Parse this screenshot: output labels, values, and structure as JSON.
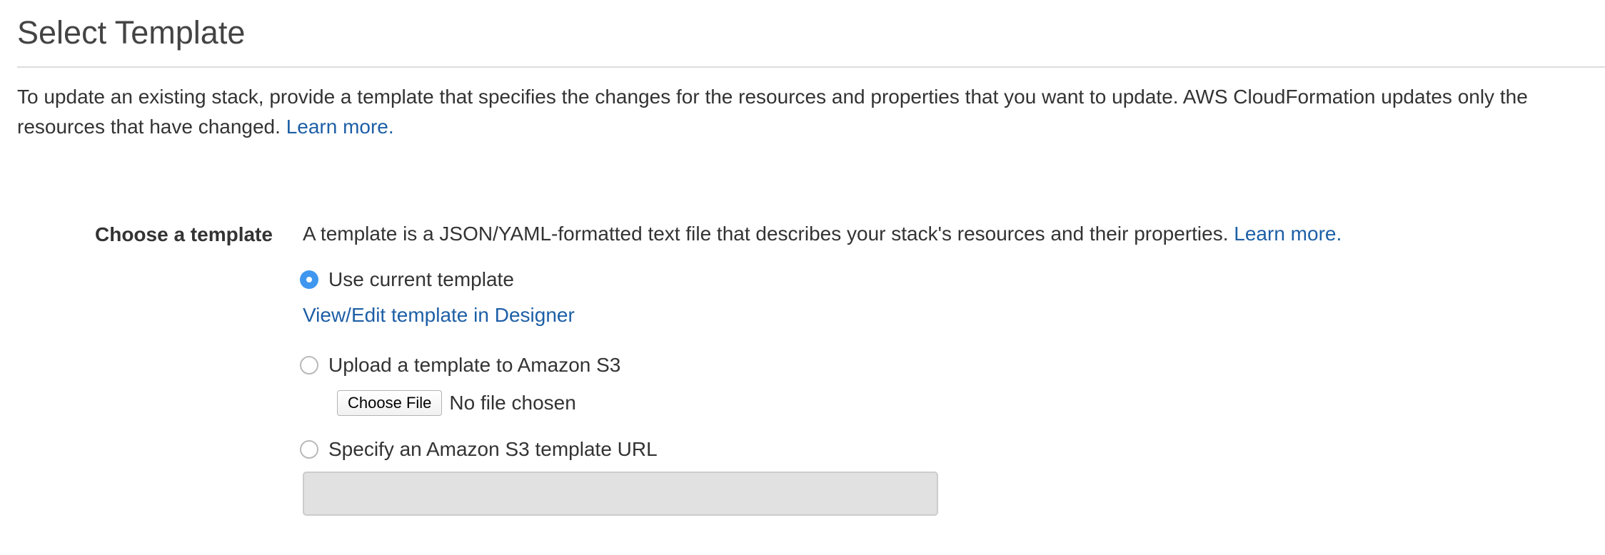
{
  "header": {
    "title": "Select Template"
  },
  "intro": {
    "text": "To update an existing stack, provide a template that specifies the changes for the resources and properties that you want to update. AWS CloudFormation updates only the resources that have changed. ",
    "learn_more": "Learn more."
  },
  "template_field": {
    "label": "Choose a template",
    "description": "A template is a JSON/YAML-formatted text file that describes your stack's resources and their properties. ",
    "learn_more": "Learn more.",
    "options": [
      {
        "label": "Use current template",
        "selected": true
      },
      {
        "label": "Upload a template to Amazon S3",
        "selected": false
      },
      {
        "label": "Specify an Amazon S3 template URL",
        "selected": false
      }
    ],
    "designer_link": "View/Edit template in Designer",
    "file_upload": {
      "button_label": "Choose File",
      "status": "No file chosen"
    },
    "url_input": {
      "value": "",
      "disabled": true
    }
  },
  "colors": {
    "link": "#1d5fa6",
    "radio_selected": "#3f97ef",
    "disabled_input_bg": "#e1e1e1",
    "rule": "#dddddd"
  }
}
